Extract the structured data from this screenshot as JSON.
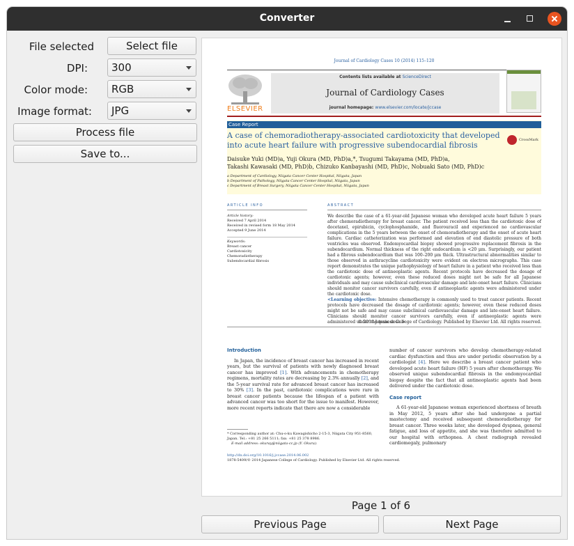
{
  "window": {
    "title": "Converter"
  },
  "controls": {
    "file_label": "File selected",
    "select_file": "Select file",
    "dpi_label": "DPI:",
    "dpi_value": "300",
    "color_label": "Color mode:",
    "color_value": "RGB",
    "format_label": "Image format:",
    "format_value": "JPG",
    "process": "Process file",
    "save": "Save to..."
  },
  "pager": {
    "label": "Page 1 of 6",
    "prev": "Previous Page",
    "next": "Next Page"
  },
  "doc": {
    "journal_line": "Journal of Cardiology Cases 10 (2014) 115–120",
    "contents_prefix": "Contents lists available at ",
    "contents_link": "ScienceDirect",
    "journal_name": "Journal of Cardiology Cases",
    "homepage_prefix": "journal homepage: ",
    "homepage_url": "www.elsevier.com/locate/jccase",
    "publisher": "ELSEVIER",
    "section": "Case Report",
    "title": "A case of chemoradiotherapy-associated cardiotoxicity that developed into acute heart failure with progressive subendocardial fibrosis",
    "crossmark": "CrossMark",
    "authors_1": "Daisuke Yuki (MD)a, Yuji Okura (MD, PhD)a,*, Tsugumi Takayama (MD, PhD)a,",
    "authors_2": "Takashi Kawasaki (MD, PhD)b, Chizuko Kanbayashi (MD, PhD)c, Nobuaki Sato (MD, PhD)c",
    "affil_a": "a Department of Cardiology, Niigata Cancer Center Hospital, Niigata, Japan",
    "affil_b": "b Department of Pathology, Niigata Cancer Center Hospital, Niigata, Japan",
    "affil_c": "c Department of Breast Surgery, Niigata Cancer Center Hospital, Niigata, Japan",
    "article_info_head": "ARTICLE INFO",
    "abstract_head": "ABSTRACT",
    "history_head": "Article history:",
    "received": "Received 7 April 2014",
    "revised": "Received in revised form 18 May 2014",
    "accepted": "Accepted 9 June 2014",
    "keywords_head": "Keywords:",
    "kw1": "Breast cancer",
    "kw2": "Cardiotoxicity",
    "kw3": "Chemoradiotherapy",
    "kw4": "Subendocardial fibrosis",
    "abstract": "We describe the case of a 61-year-old Japanese woman who developed acute heart failure 5 years after chemoradiotherapy for breast cancer. The patient received less than the cardiotoxic dose of docetaxel, epirubicin, cyclophosphamide, and fluorouracil and experienced no cardiovascular complications in the 5 years between the onset of chemoradiotherapy and the onset of acute heart failure. Cardiac catheterization was performed and elevation of end diastolic pressure of both ventricles was observed. Endomyocardial biopsy showed progressive replacement fibrosis in the subendocardium. Normal thickness of the right endocardium is <20 μm. Surprisingly, our patient had a fibrous subendocardium that was 100–200 μm thick. Ultrastructural abnormalities similar to those observed in anthracycline cardiotoxicity were evident on electron micrographs. This case report demonstrates the unique pathophysiology of heart failure in a patient who received less than the cardiotoxic dose of antineoplastic agents. Recent protocols have decreased the dosage of cardiotoxic agents; however, even these reduced doses might not be safe for all Japanese individuals and may cause subclinical cardiovascular damage and late-onset heart failure. Clinicians should monitor cancer survivors carefully, even if antineoplastic agents were administered under the cardiotoxic dose.",
    "lo_label": "<Learning objective:",
    "lo_text": " Intensive chemotherapy is commonly used to treat cancer patients. Recent protocols have decreased the dosage of cardiotoxic agents; however, even these reduced doses might not be safe and may cause subclinical cardiovascular damage and late-onset heart failure. Clinicians should monitor cancer survivors carefully, even if antineoplastic agents were administered under the toxic dose.>",
    "copyright": "© 2014 Japanese College of Cardiology. Published by Elsevier Ltd. All rights reserved.",
    "intro_head": "Introduction",
    "intro_a": "In Japan, the incidence of breast cancer has increased in recent years, but the survival of patients with newly diagnosed breast cancer has improved ",
    "ref1": "[1]",
    "intro_b": ". With advancements in chemotherapy regimens, mortality rates are decreasing by 2.3% annually ",
    "ref2": "[2]",
    "intro_c": ", and the 5-year survival rate for advanced breast cancer has increased to 30% ",
    "ref3": "[3]",
    "intro_d": ". In the past, cardiotoxic complications were rare in breast cancer patients because the lifespan of a patient with advanced cancer was too short for the issue to manifest. However, more recent reports indicate that there are now a considerable",
    "right_a": "number of cancer survivors who develop chemotherapy-related cardiac dysfunction and thus are under periodic observation by a cardiologist ",
    "ref4": "[4]",
    "right_b": ". Here we describe a breast cancer patient who developed acute heart failure (HF) 5 years after chemotherapy. We observed unique subendocardial fibrosis in the endomyocardial biopsy despite the fact that all antineoplastic agents had been delivered under the cardiotoxic dose.",
    "case_head": "Case report",
    "case_text": "A 61-year-old Japanese woman experienced shortness of breath in May 2012, 5 years after she had undergone a partial mastectomy and received subsequent chemoradiotherapy for breast cancer. Three weeks later, she developed dyspnea, general fatigue, and loss of appetite, and she was therefore admitted to our hospital with orthopnea. A chest radiograph revealed cardiomegaly, pulmonary",
    "corresponding": "* Corresponding author at: Chu-o-ku Kawagishicho 2-15-3, Niigata City 951-8560, Japan. Tel.: +81 25 266 5111; fax: +81 25 378 8986.",
    "email": "E-mail address: okuray@niigata-cc.jp (Y. Okura).",
    "doi": "http://dx.doi.org/10.1016/j.jccase.2014.06.002",
    "issn": "1878-5409/© 2014 Japanese College of Cardiology. Published by Elsevier Ltd. All rights reserved."
  }
}
